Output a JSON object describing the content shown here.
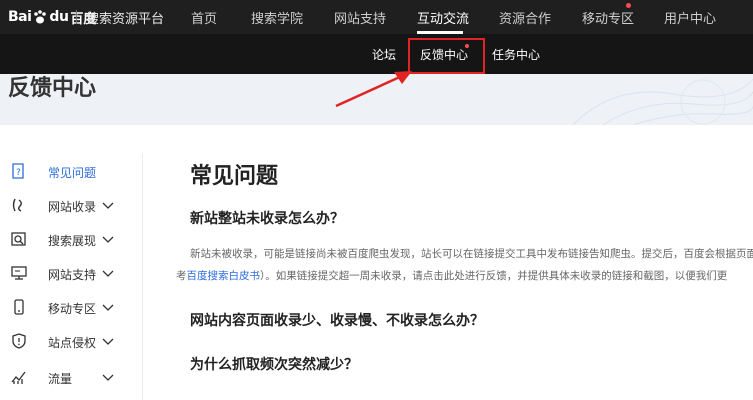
{
  "header": {
    "logo_text_left": "Bai",
    "logo_text_right": "du",
    "logo_text_cn": "百度",
    "site_name": "搜索资源平台",
    "nav": [
      {
        "label": "首页"
      },
      {
        "label": "搜索学院"
      },
      {
        "label": "网站支持"
      },
      {
        "label": "互动交流"
      },
      {
        "label": "资源合作"
      },
      {
        "label": "移动专区"
      },
      {
        "label": "用户中心"
      }
    ],
    "active_nav": "互动交流"
  },
  "subnav": {
    "items": [
      {
        "label": "论坛"
      },
      {
        "label": "反馈中心"
      },
      {
        "label": "任务中心"
      }
    ],
    "highlighted": "反馈中心"
  },
  "banner": {
    "title": "反馈中心"
  },
  "sidebar": {
    "items": [
      {
        "label": "常见问题",
        "icon": "question-doc-icon",
        "active": true
      },
      {
        "label": "网站收录",
        "icon": "index-icon"
      },
      {
        "label": "搜索展现",
        "icon": "search-display-icon"
      },
      {
        "label": "网站支持",
        "icon": "monitor-icon"
      },
      {
        "label": "移动专区",
        "icon": "mobile-icon"
      },
      {
        "label": "站点侵权",
        "icon": "shield-icon"
      },
      {
        "label": "流量",
        "icon": "traffic-chart-icon"
      }
    ]
  },
  "main": {
    "title": "常见问题",
    "q1": "新站整站未收录怎么办？",
    "p1_line1": "新站未被收录，可能是链接尚未被百度爬虫发现，站长可以在链接提交工具中发布链接告知爬虫。提交后，百度会根据页面",
    "p1_line2_prefix": "考",
    "p1_line2_link": "百度搜索白皮书",
    "p1_line2_suffix": "）。如果链接提交超一周未收录，请点击此处进行反馈，并提供具体未收录的链接和截图，以便我们更",
    "q2": "网站内容页面收录少、收录慢、不收录怎么办？",
    "q3": "为什么抓取频次突然减少？"
  },
  "colors": {
    "topbar_bg": "#1f1f1f",
    "subbar_bg": "#151515",
    "accent_blue": "#2d6cdf",
    "highlight_red": "#e02424"
  }
}
